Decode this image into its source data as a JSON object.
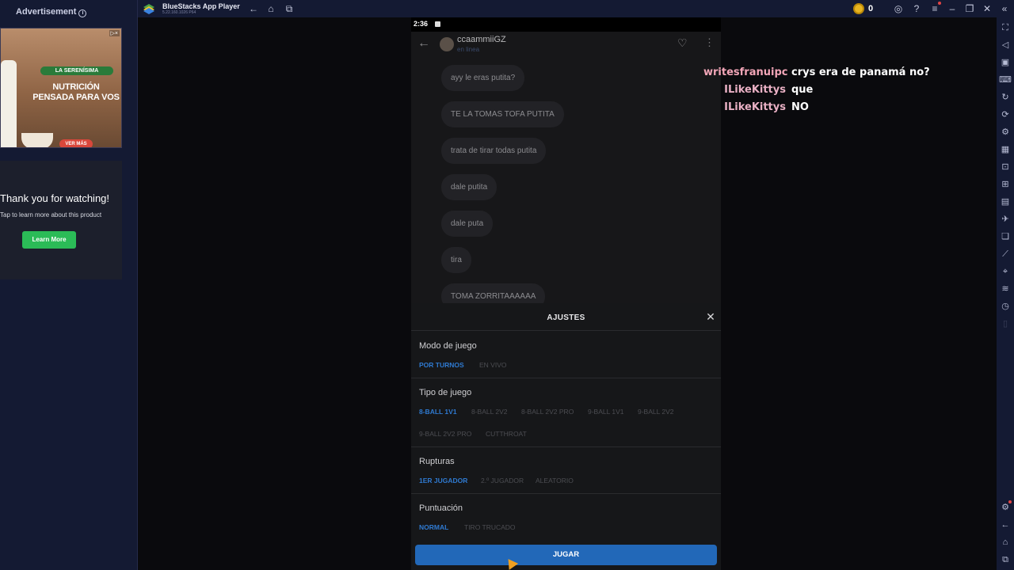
{
  "ad": {
    "label": "Advertisement",
    "banner_brand": "LA SERENÍSIMA",
    "banner_headline": "NUTRICIÓN PENSADA PARA VOS",
    "banner_cta": "VER MÁS",
    "card_thanks": "Thank you for watching!",
    "card_sub": "Tap to learn more about this product",
    "card_button": "Learn More"
  },
  "topbar": {
    "title": "BlueStacks App Player",
    "version": "5.22.160.1026 P64",
    "coins": "0"
  },
  "phone": {
    "status_time": "2:36",
    "chat_name": "ccaammiiGZ",
    "chat_sub": "en linea",
    "messages": [
      "ayy le eras putita?",
      "TE LA TOMAS TOFA PUTITA",
      "trata de tirar todas putita",
      "dale putita",
      "dale puta",
      "tira",
      "TOMA ZORRITAAAAAA"
    ]
  },
  "settings": {
    "title": "AJUSTES",
    "sections": [
      {
        "label": "Modo de juego",
        "options": [
          "POR TURNOS",
          "EN VIVO"
        ]
      },
      {
        "label": "Tipo de juego",
        "options": [
          "8-BALL 1V1",
          "8-BALL 2V2",
          "8-BALL 2V2 PRO",
          "9-BALL 1V1",
          "9-BALL 2V2",
          "9-BALL 2V2 PRO",
          "CUTTHROAT"
        ]
      },
      {
        "label": "Rupturas",
        "options": [
          "1ER JUGADOR",
          "2.º JUGADOR",
          "ALEATORIO"
        ]
      },
      {
        "label": "Puntuación",
        "options": [
          "NORMAL",
          "TIRO TRUCADO"
        ]
      }
    ],
    "play_button": "JUGAR"
  },
  "stream_chat": [
    {
      "user": "writesfranuipc",
      "message": "crys era de panamá no?"
    },
    {
      "user": "ILikeKittys",
      "message": "que"
    },
    {
      "user": "ILikeKittys",
      "message": "NO"
    }
  ],
  "colors": {
    "accent_blue": "#2f7ad1",
    "button_blue": "#2268b8",
    "chat_user": "#f3a6b8",
    "bluestacks_bar": "#141a33"
  }
}
